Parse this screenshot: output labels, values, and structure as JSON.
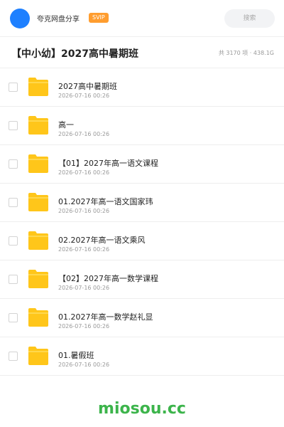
{
  "header": {
    "app_name": "夸克网盘分享",
    "badge": "SVIP",
    "search_placeholder": "搜索"
  },
  "folder": {
    "title": "【中小幼】2027高中暑期班",
    "meta": "共 3170 项 · 438.1G"
  },
  "files": [
    {
      "name": "2027高中暑期班",
      "date": "2026-07-16 00:26"
    },
    {
      "name": "高一",
      "date": "2026-07-16 00:26"
    },
    {
      "name": "【01】2027年高一语文课程",
      "date": "2026-07-16 00:26"
    },
    {
      "name": "01.2027年高一语文国家玮",
      "date": "2026-07-16 00:26"
    },
    {
      "name": "02.2027年高一语文乘风",
      "date": "2026-07-16 00:26"
    },
    {
      "name": "【02】2027年高一数学课程",
      "date": "2026-07-16 00:26"
    },
    {
      "name": "01.2027年高一数学赵礼显",
      "date": "2026-07-16 00:26"
    },
    {
      "name": "01.暑假班",
      "date": "2026-07-16 00:26"
    }
  ],
  "icons": {
    "folder": "folder-icon",
    "checkbox": "checkbox"
  },
  "colors": {
    "accent": "#1e80ff",
    "badge": "#ff9d2f",
    "folder": "#ffc61a",
    "watermark": "#3cb44b"
  },
  "watermark": "miosou.cc"
}
